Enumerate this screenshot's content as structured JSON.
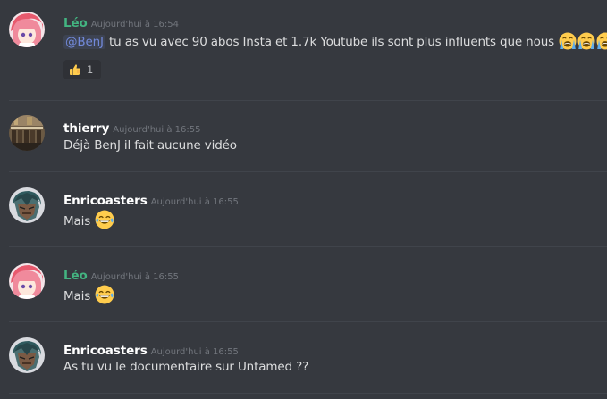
{
  "messages": [
    {
      "author": "Léo",
      "time": "Aujourd'hui à 16:54",
      "mention": "@BenJ",
      "text": "tu as vu avec 90 abos Insta et 1.7k Youtube ils sont plus influents que nous",
      "emojis": [
        "loudly-crying-face-icon",
        "loudly-crying-face-icon",
        "loudly-crying-face-icon"
      ],
      "reaction": {
        "emoji": "thumbs-up-icon",
        "count": "1"
      },
      "author_color": "#43b581"
    },
    {
      "author": "thierry",
      "time": "Aujourd'hui à 16:55",
      "text": "Déjà BenJ il fait aucune vidéo",
      "author_color": "#ffffff"
    },
    {
      "author": "Enricoasters",
      "time": "Aujourd'hui à 16:55",
      "text": "Mais",
      "emojis": [
        "tears-of-joy-icon"
      ],
      "author_color": "#ffffff"
    },
    {
      "author": "Léo",
      "time": "Aujourd'hui à 16:55",
      "text": "Mais",
      "emojis": [
        "tears-of-joy-icon"
      ],
      "author_color": "#43b581"
    },
    {
      "author": "Enricoasters",
      "time": "Aujourd'hui à 16:55",
      "text": "As tu vu le documentaire sur Untamed ??",
      "author_color": "#ffffff"
    }
  ],
  "colors": {
    "background": "#36393f",
    "divider": "#40444b",
    "mention": "#7289da",
    "timestamp": "#72767d"
  }
}
